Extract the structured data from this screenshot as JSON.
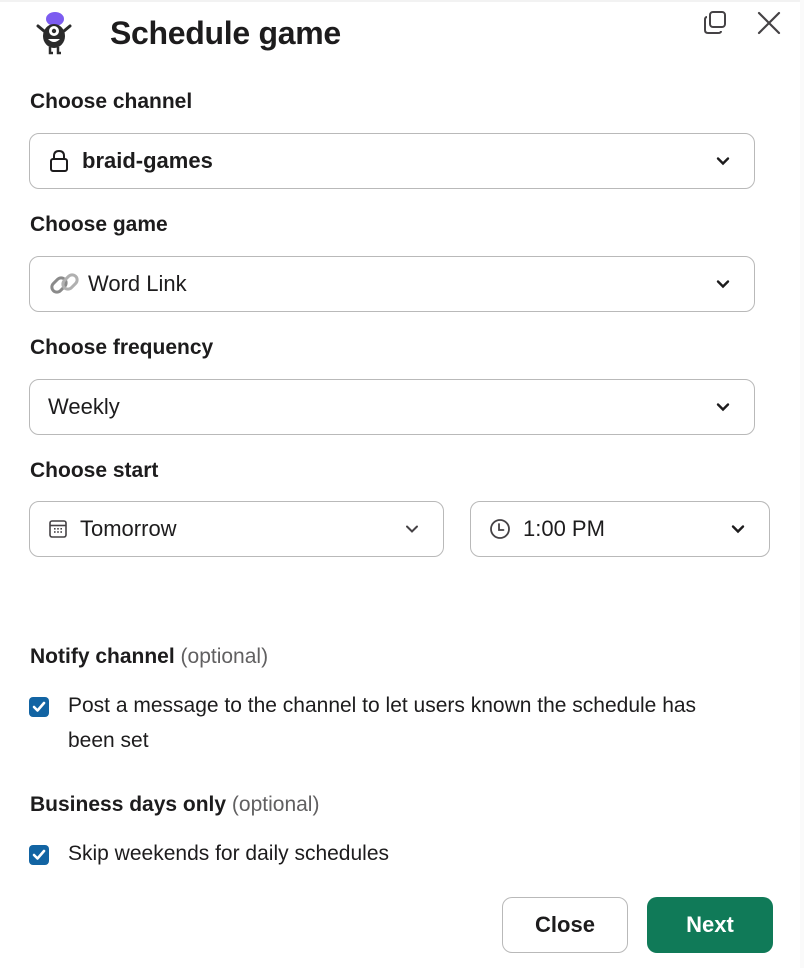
{
  "header": {
    "title": "Schedule game",
    "logo_icon": "monster-mascot-logo",
    "popout_icon": "popout-window-icon",
    "close_icon": "close-x-icon"
  },
  "form": {
    "channel": {
      "label": "Choose channel",
      "value": "braid-games",
      "icon": "lock-icon"
    },
    "game": {
      "label": "Choose game",
      "value": "Word Link",
      "icon": "link-icon"
    },
    "frequency": {
      "label": "Choose frequency",
      "value": "Weekly"
    },
    "start": {
      "label": "Choose start",
      "date_value": "Tomorrow",
      "date_icon": "calendar-icon",
      "time_value": "1:00 PM",
      "time_icon": "clock-icon"
    },
    "notify": {
      "label": "Notify channel",
      "optional": "(optional)",
      "checkbox_text": "Post a message to the channel to let users known the schedule has been set",
      "checked": true
    },
    "business_days": {
      "label": "Business days only",
      "optional": "(optional)",
      "checkbox_text": "Skip weekends for daily schedules",
      "checked": true
    }
  },
  "footer": {
    "close_label": "Close",
    "next_label": "Next"
  },
  "colors": {
    "primary_button": "#107a58",
    "checkbox": "#1264a3",
    "logo_hat": "#7c5cf0"
  }
}
